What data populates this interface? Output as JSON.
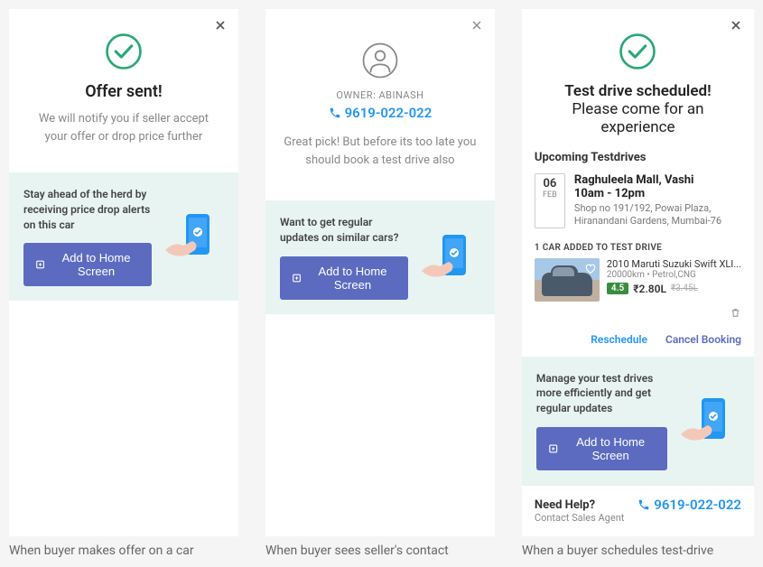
{
  "col1": {
    "title": "Offer sent!",
    "sub": "We will notify you if seller accept your offer or drop price further",
    "promo_text": "Stay ahead of the herd by receiving price drop alerts on this car",
    "a2hs": "Add to Home Screen",
    "caption": "When buyer makes offer on a car"
  },
  "col2": {
    "owner_label": "OWNER: ABINASH",
    "phone": "9619-022-022",
    "sub": "Great pick! But before its too late you should book a test drive also",
    "promo_text": "Want to get regular updates on similar cars?",
    "a2hs": "Add to Home Screen",
    "caption": "When buyer sees seller's contact"
  },
  "col3": {
    "title_bold": "Test drive scheduled!",
    "title_rest": " Please come for an experience",
    "upcoming": "Upcoming Testdrives",
    "date_day": "06",
    "date_mon": "FEB",
    "loc_name": "Raghuleela Mall, Vashi",
    "loc_time": "10am - 12pm",
    "loc_addr": "Shop no 191/192, Powai Plaza, Hiranandani Gardens, Mumbai-76",
    "added": "1 CAR ADDED TO TEST DRIVE",
    "car_name": "2010 Maruti Suzuki Swift XLI...",
    "car_meta": "20000km • Petrol,CNG",
    "rating": "4.5",
    "price": "₹2.80L",
    "old_price": "₹3.45L",
    "reschedule": "Reschedule",
    "cancel": "Cancel Booking",
    "promo_text": "Manage your test drives more efficiently and get regular updates",
    "a2hs": "Add to Home Screen",
    "help_title": "Need Help?",
    "help_sub": "Contact Sales Agent",
    "help_phone": "9619-022-022",
    "caption": "When a buyer schedules test-drive"
  }
}
